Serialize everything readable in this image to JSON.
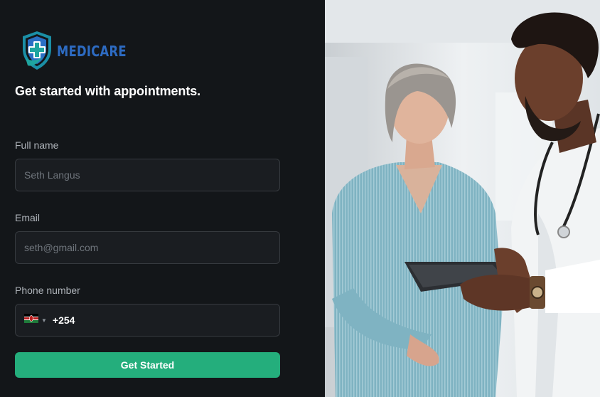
{
  "brand": {
    "name": "MEDICARE"
  },
  "headline": "Get started with appointments.",
  "form": {
    "full_name": {
      "label": "Full name",
      "placeholder": "Seth Langus"
    },
    "email": {
      "label": "Email",
      "placeholder": "seth@gmail.com"
    },
    "phone": {
      "label": "Phone number",
      "country_flag": "kenya-flag-icon",
      "dial_code": "+254"
    },
    "submit_label": "Get Started"
  },
  "hero_image": {
    "subject": "doctor-and-patient-photo"
  },
  "colors": {
    "background": "#131619",
    "input_bg": "#1a1d21",
    "input_border": "#363a3f",
    "accent": "#24ae7c",
    "brand_blue": "#2d6bc2",
    "brand_teal": "#1fa5a0"
  }
}
